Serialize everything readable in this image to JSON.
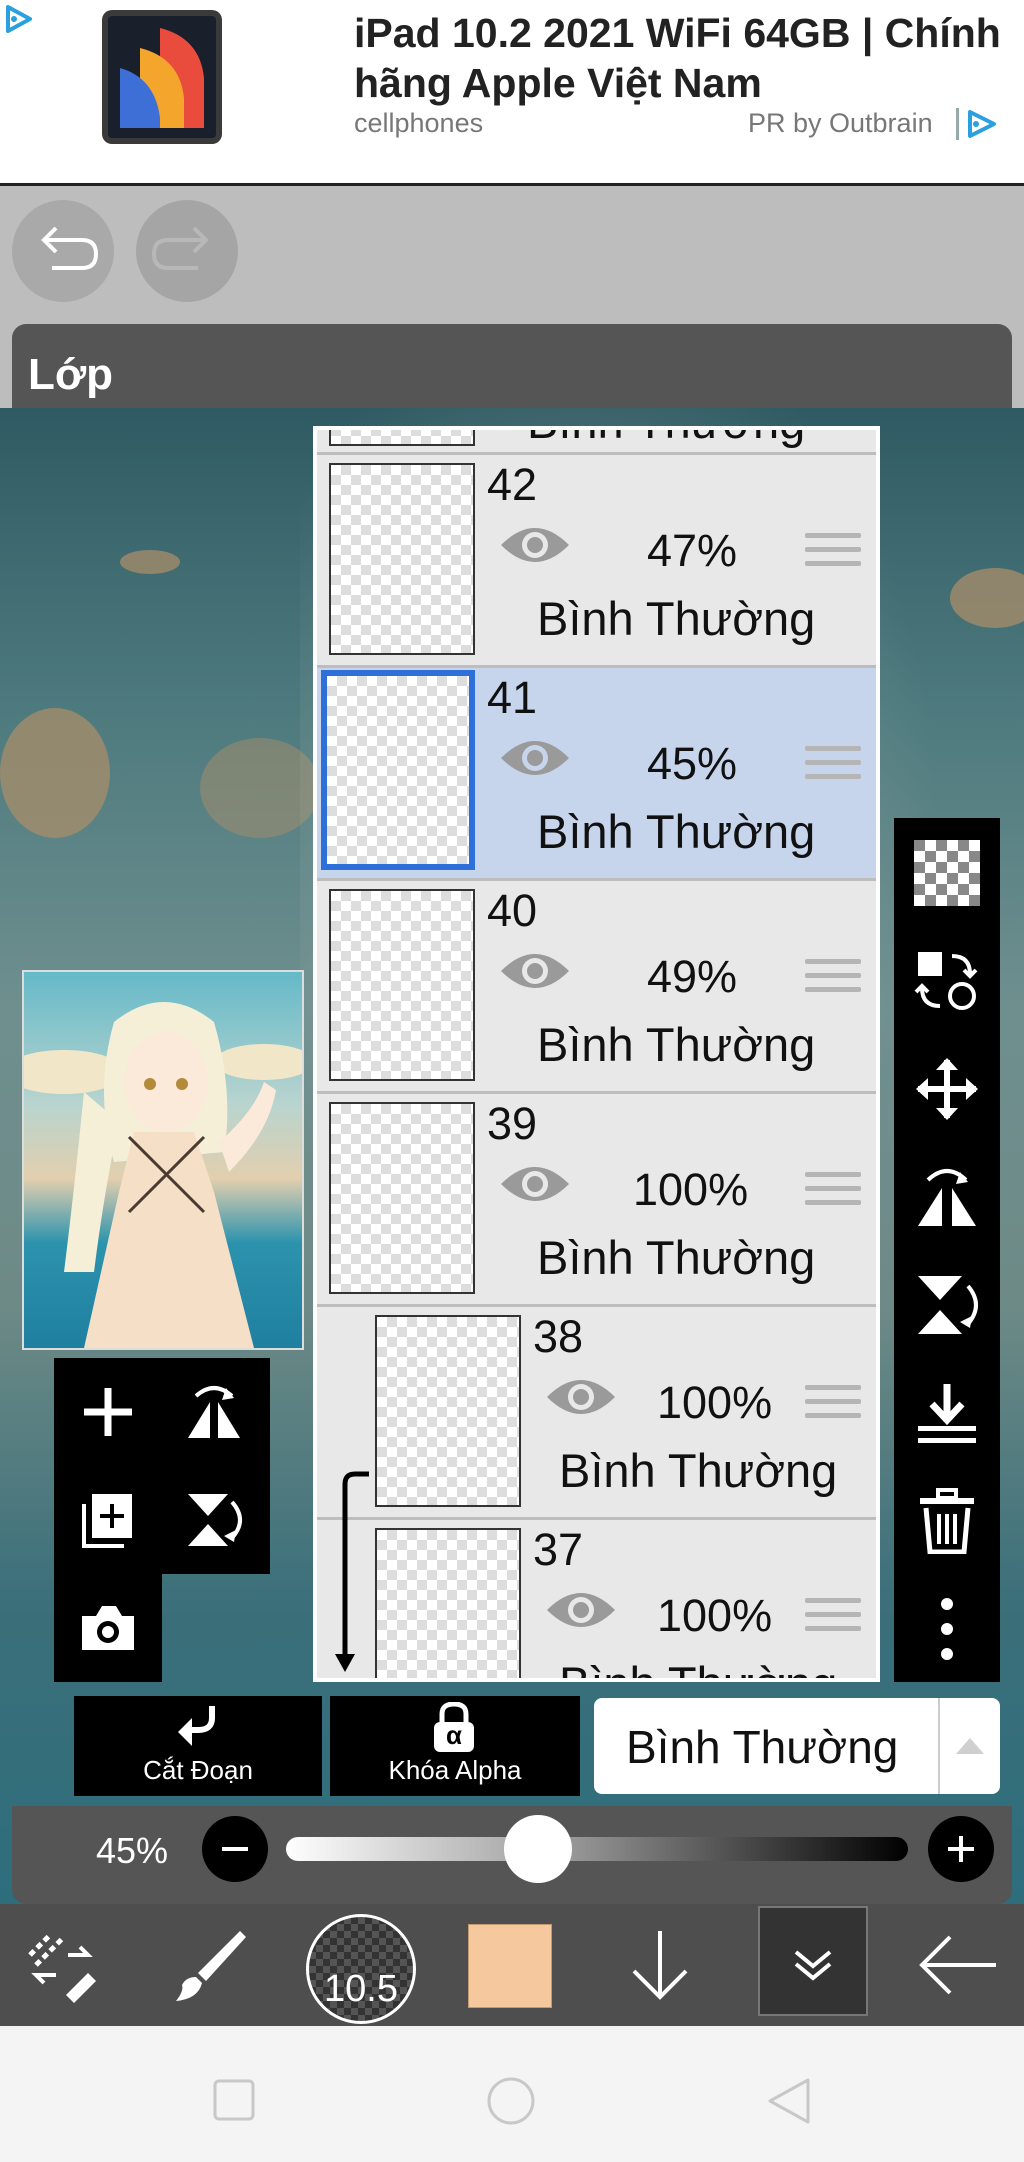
{
  "ad": {
    "title": "iPad 10.2 2021 WiFi 64GB | Chính hãng Apple Việt Nam",
    "source": "cellphones",
    "sponsor": "PR by Outbrain"
  },
  "panel": {
    "title": "Lớp"
  },
  "layers": [
    {
      "number": "42",
      "opacity": "47%",
      "mode": "Bình Thường",
      "selected": false
    },
    {
      "number": "41",
      "opacity": "45%",
      "mode": "Bình Thường",
      "selected": true
    },
    {
      "number": "40",
      "opacity": "49%",
      "mode": "Bình Thường",
      "selected": false
    },
    {
      "number": "39",
      "opacity": "100%",
      "mode": "Bình Thường",
      "selected": false
    },
    {
      "number": "38",
      "opacity": "100%",
      "mode": "Bình Thường",
      "selected": false,
      "clipped": true
    },
    {
      "number": "37",
      "opacity": "100%",
      "mode": "Bình Thường",
      "selected": false,
      "clipped": true
    }
  ],
  "partial_top_layer_mode": "Bình Thường",
  "buttons": {
    "clip": "Cắt Đoạn",
    "alpha": "Khóa Alpha",
    "alpha_glyph": "α"
  },
  "blend_mode": "Bình Thường",
  "opacity": {
    "label": "45%",
    "value": 0.45
  },
  "brush_size": "10.5",
  "colors": {
    "current": "#f5c99d",
    "selection": "#2e6fd9"
  },
  "icons": {
    "top": [
      "undo-icon",
      "redo-icon"
    ],
    "right_toolbar": [
      "transparency-icon",
      "layer-swap-icon",
      "move-icon",
      "flip-horizontal-icon",
      "flip-vertical-icon",
      "merge-down-icon",
      "trash-icon",
      "more-icon"
    ],
    "left_toolbar": [
      "add-layer-icon",
      "flip-layer-horizontal-icon",
      "copy-layer-icon",
      "flip-layer-vertical-icon",
      "camera-icon"
    ],
    "bottom": [
      "transform-icon",
      "brush-icon",
      "brush-size-icon",
      "color-icon",
      "arrow-down-icon",
      "layer-menu-icon",
      "back-icon"
    ],
    "system": [
      "recent-apps-icon",
      "home-icon",
      "back-nav-icon"
    ]
  }
}
